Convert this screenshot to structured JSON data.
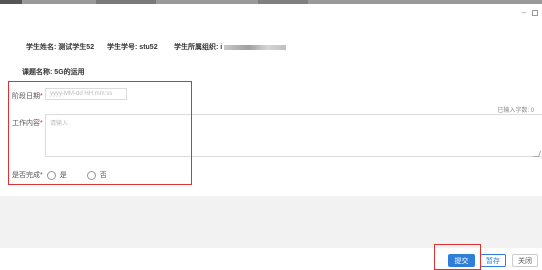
{
  "window": {
    "minimize_glyph": "–",
    "maximize_icon": "maximize-icon"
  },
  "student": {
    "name_label": "学生姓名:",
    "name_value": "测试学生52",
    "id_label": "学生学号:",
    "id_value": "stu52",
    "org_label": "学生所属组织:",
    "org_value_prefix": "i"
  },
  "topic": {
    "label": "课题名称:",
    "value": "5G的运用"
  },
  "form": {
    "date_label": "阶段日期",
    "date_placeholder": "yyyy-MM-dd HH:mm:ss",
    "content_label": "工作内容",
    "content_placeholder": "请输入",
    "counter_text": "已输入字数: 0",
    "complete_label": "是否完成",
    "option_yes": "是",
    "option_no": "否",
    "required_mark": "*"
  },
  "buttons": {
    "submit": "提交",
    "draft": "暂存",
    "close": "关闭"
  },
  "colors": {
    "primary": "#2f7fd8",
    "highlight": "#e03030",
    "required": "#e02020"
  }
}
